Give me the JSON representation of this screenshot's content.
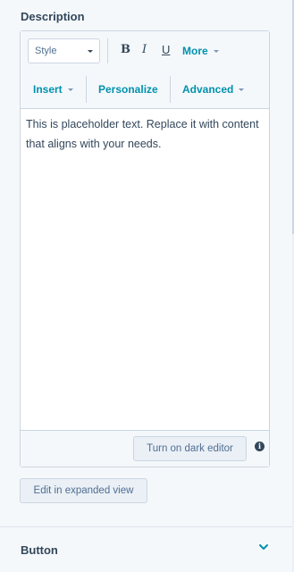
{
  "description": {
    "label": "Description",
    "toolbar": {
      "style_select": "Style",
      "bold": "B",
      "italic": "I",
      "underline": "U",
      "more": "More",
      "insert": "Insert",
      "personalize": "Personalize",
      "advanced": "Advanced"
    },
    "content": "This is placeholder text. Replace it with content that aligns with your needs.",
    "dark_editor_button": "Turn on dark editor",
    "info_icon": "i"
  },
  "expanded_view_button": "Edit in expanded view",
  "button_section": {
    "label": "Button"
  },
  "colors": {
    "accent": "#0091ae",
    "text": "#33475b",
    "border": "#cbd6e2",
    "background": "#f5f8fa"
  }
}
